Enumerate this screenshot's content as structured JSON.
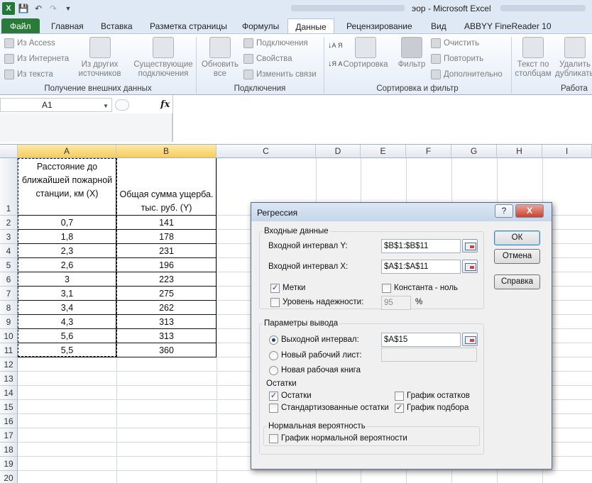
{
  "window": {
    "title": "эор - Microsoft Excel"
  },
  "tabs": [
    "Файл",
    "Главная",
    "Вставка",
    "Разметка страницы",
    "Формулы",
    "Данные",
    "Рецензирование",
    "Вид",
    "ABBYY FineReader 10"
  ],
  "ribbon": {
    "groups": {
      "external": "Получение внешних данных",
      "connections": "Подключения",
      "sort_filter": "Сортировка и фильтр",
      "data_tools": "Работа"
    },
    "from_access": "Из Access",
    "from_web": "Из Интернета",
    "from_text": "Из текста",
    "from_other_1": "Из других",
    "from_other_2": "источников",
    "existing_1": "Существующие",
    "existing_2": "подключения",
    "refresh_1": "Обновить",
    "refresh_2": "все",
    "connections_btn": "Подключения",
    "properties": "Свойства",
    "edit_links": "Изменить связи",
    "sort": "Сортировка",
    "filter": "Фильтр",
    "clear": "Очистить",
    "reapply": "Повторить",
    "advanced": "Дополнительно",
    "text_to_cols_1": "Текст по",
    "text_to_cols_2": "столбцам",
    "remove_dups_1": "Удалить",
    "remove_dups_2": "дубликаты",
    "sort_az": "А Я",
    "sort_za": "Я А"
  },
  "formula_bar": {
    "name_box": "A1",
    "fx": "fx"
  },
  "sheet": {
    "columns": [
      "A",
      "B",
      "C",
      "D",
      "E",
      "F",
      "G",
      "H",
      "I"
    ],
    "rows": [
      "1",
      "2",
      "3",
      "4",
      "5",
      "6",
      "7",
      "8",
      "9",
      "10",
      "11",
      "12",
      "13",
      "14",
      "15",
      "16",
      "17",
      "18",
      "19",
      "20"
    ],
    "header_x": "Расстояние до ближайшей пожарной станции, км (X)",
    "header_y": "Общая сумма ущерба. тыс. руб. (Y)",
    "x_values": [
      "0,7",
      "1,8",
      "2,3",
      "2,6",
      "3",
      "3,1",
      "3,4",
      "4,3",
      "5,6",
      "5,5"
    ],
    "y_values": [
      "141",
      "178",
      "231",
      "196",
      "223",
      "275",
      "262",
      "313",
      "313",
      "360"
    ]
  },
  "dialog": {
    "title": "Регрессия",
    "help_glyph": "?",
    "close_glyph": "X",
    "input_group": "Входные данные",
    "input_y_label": "Входной интервал Y:",
    "input_y_value": "$B$1:$B$11",
    "input_x_label": "Входной интервал X:",
    "input_x_value": "$A$1:$A$11",
    "labels": "Метки",
    "labels_checked": true,
    "constant_zero": "Константа - ноль",
    "constant_zero_checked": false,
    "confidence": "Уровень надежности:",
    "confidence_checked": false,
    "confidence_value": "95",
    "confidence_unit": "%",
    "output_group": "Параметры вывода",
    "output_range": "Выходной интервал:",
    "output_range_value": "$A$15",
    "new_sheet": "Новый рабочий лист:",
    "new_workbook": "Новая рабочая книга",
    "residuals_group": "Остатки",
    "residuals": "Остатки",
    "residuals_checked": true,
    "std_residuals": "Стандартизованные остатки",
    "std_residuals_checked": false,
    "residual_plots": "График остатков",
    "residual_plots_checked": false,
    "line_fit_plots": "График подбора",
    "line_fit_plots_checked": true,
    "normal_group": "Нормальная вероятность",
    "normal_plot": "График нормальной вероятности",
    "normal_plot_checked": false,
    "ok": "ОК",
    "cancel": "Отмена",
    "help": "Справка"
  }
}
